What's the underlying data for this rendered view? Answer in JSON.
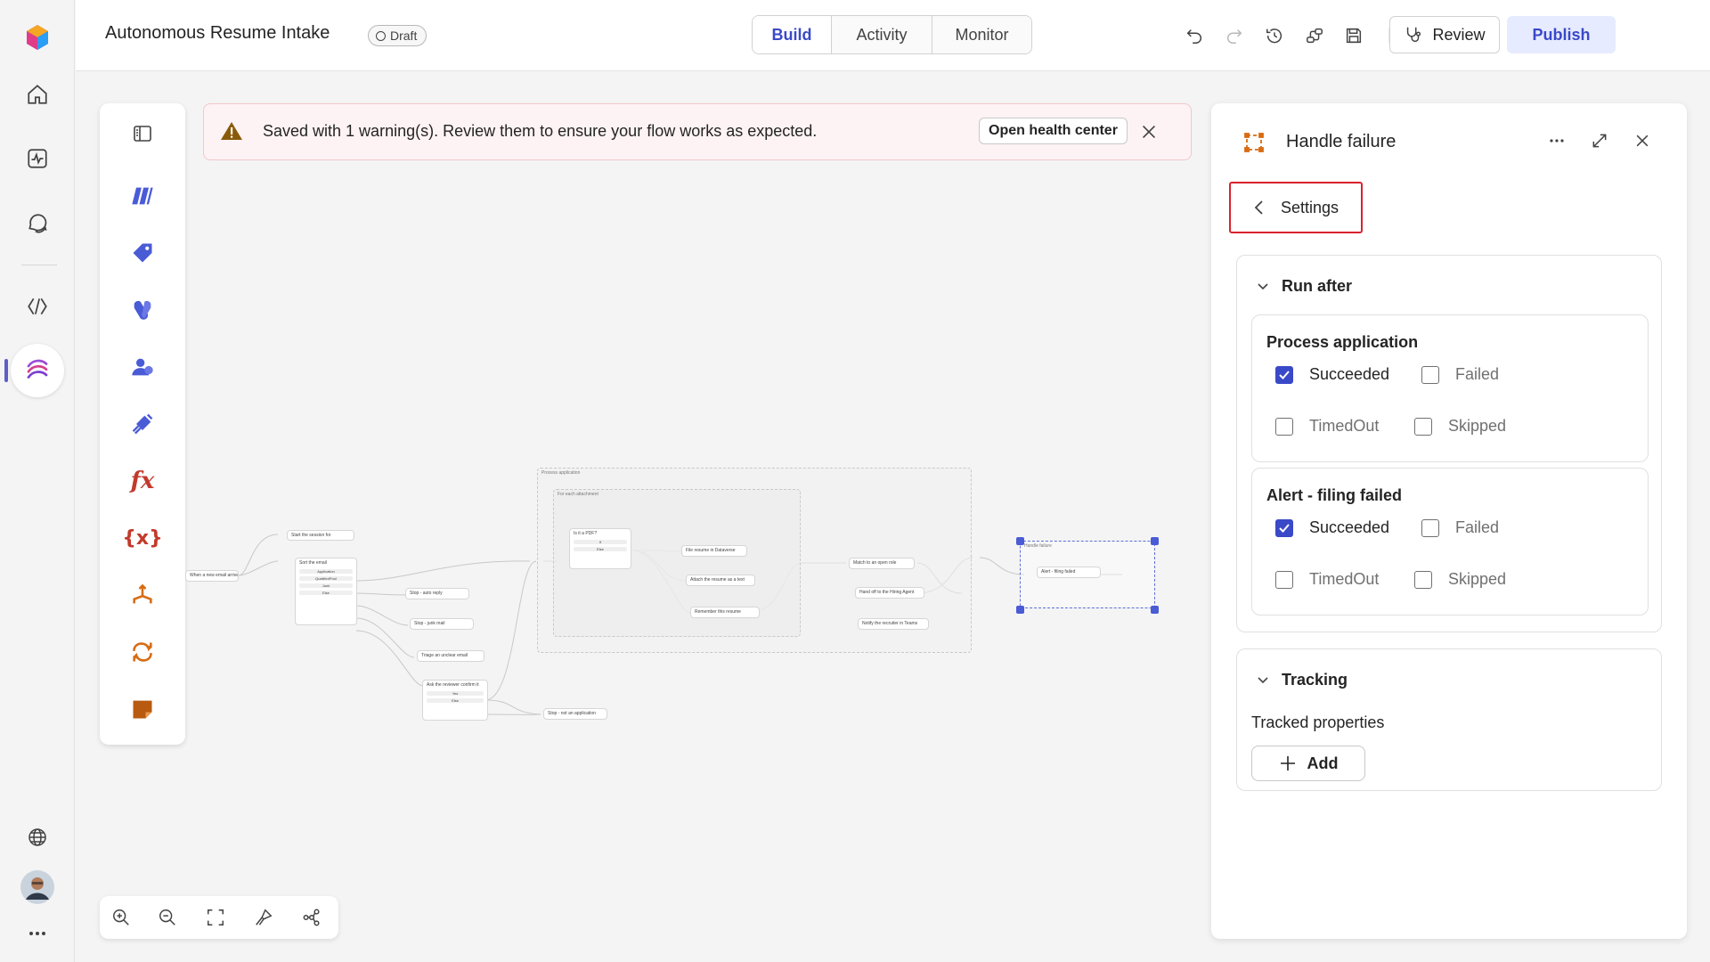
{
  "rail": {
    "icons": [
      "app-logo-icon",
      "home-icon",
      "activity-icon",
      "chat-icon",
      "code-brackets-icon",
      "flow-icon",
      "globe-icon",
      "user-avatar",
      "more-icon"
    ]
  },
  "header": {
    "title": "Autonomous Resume Intake",
    "status_badge": "Draft",
    "tabs": [
      {
        "label": "Build",
        "selected": true
      },
      {
        "label": "Activity",
        "selected": false
      },
      {
        "label": "Monitor",
        "selected": false
      }
    ],
    "review_label": "Review",
    "publish_label": "Publish"
  },
  "warning": {
    "message": "Saved with 1 warning(s). Review them to ensure your flow works as expected.",
    "button_label": "Open health center"
  },
  "canvas": {
    "nodes": {
      "trigger": "When a new email arrives",
      "start_session": "Start the session for",
      "sort_email": "Sort the email",
      "branch_application": "Application",
      "branch_quality": "QualifiedPool",
      "branch_junk": "Junk",
      "branch_else": "Else",
      "stop_auto_reply": "Stop - auto reply",
      "stop_junk": "Stop - junk mail",
      "triage_email": "Triage an unclear email",
      "ask_reviewer": "Ask the reviewer confirm it",
      "yes": "Yes",
      "else2": "Else",
      "stop_not_app": "Stop - not an application",
      "process_group": "Process application",
      "foreach_group": "For each attachment",
      "is_pdf": "Is it a PDF?",
      "pdf_yes": "If",
      "pdf_else": "Else",
      "file_dataverse": "File resume in Dataverse",
      "attach_resume": "Attach the resume as a text",
      "remember_resume": "Remember this resume",
      "match_agent": "Match to an open role",
      "handoff_agent": "Hand off to the Hiring Agent",
      "notify_recruiter": "Notify the recruiter in Teams",
      "handle_group": "Handle failure",
      "alert_node": "Alert - filing failed"
    }
  },
  "panel": {
    "title": "Handle failure",
    "back_label": "Settings",
    "run_after": {
      "heading": "Run after",
      "groups": [
        {
          "name": "Process application",
          "options": [
            {
              "label": "Succeeded",
              "checked": true
            },
            {
              "label": "Failed",
              "checked": false
            },
            {
              "label": "TimedOut",
              "checked": false
            },
            {
              "label": "Skipped",
              "checked": false
            }
          ]
        },
        {
          "name": "Alert - filing failed",
          "options": [
            {
              "label": "Succeeded",
              "checked": true
            },
            {
              "label": "Failed",
              "checked": false
            },
            {
              "label": "TimedOut",
              "checked": false
            },
            {
              "label": "Skipped",
              "checked": false
            }
          ]
        }
      ]
    },
    "tracking": {
      "heading": "Tracking",
      "tracked_label": "Tracked properties",
      "add_label": "Add"
    }
  },
  "colors": {
    "accent": "#3a49c8",
    "warning_bg": "#fdf3f4",
    "highlight_border": "#d9232d",
    "orange": "#d76c14",
    "node_red": "#c0392b"
  }
}
